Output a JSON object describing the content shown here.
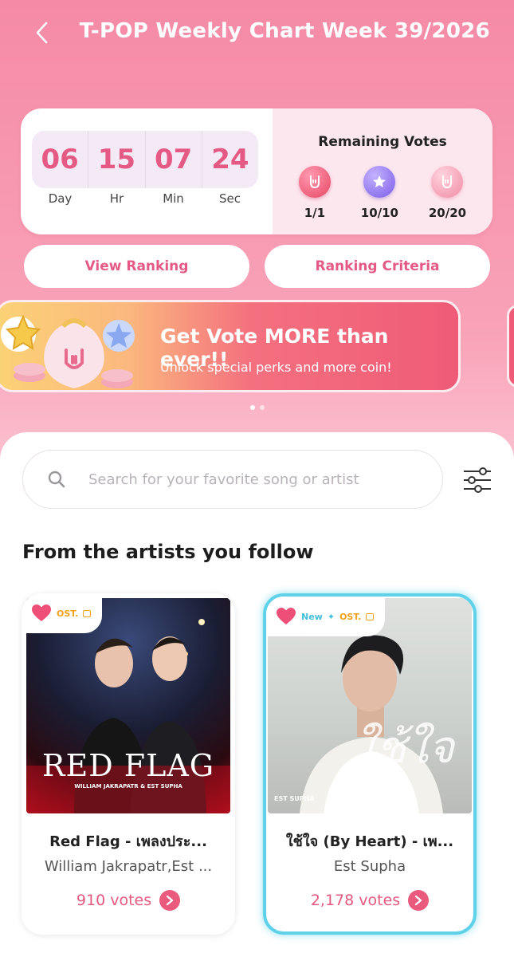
{
  "header": {
    "title": "T-POP Weekly Chart Week 39/2026"
  },
  "countdown": {
    "cells": [
      {
        "value": "06",
        "label": "Day"
      },
      {
        "value": "15",
        "label": "Hr"
      },
      {
        "value": "07",
        "label": "Min"
      },
      {
        "value": "24",
        "label": "Sec"
      }
    ]
  },
  "remaining_votes": {
    "title": "Remaining Votes",
    "coins": [
      {
        "icon": "rock-hand-coin-icon",
        "count": "1/1",
        "color": "#e84563"
      },
      {
        "icon": "star-coin-icon",
        "count": "10/10",
        "color": "#7b5ce8"
      },
      {
        "icon": "pink-hand-coin-icon",
        "count": "20/20",
        "color": "#f08aa3"
      }
    ]
  },
  "actions": {
    "view_ranking": "View Ranking",
    "ranking_criteria": "Ranking Criteria"
  },
  "banner": {
    "title": "Get Vote MORE than ever!!",
    "subtitle": "Unlock special perks and more coin!",
    "page_count": 2,
    "active_page": 1
  },
  "search": {
    "placeholder": "Search for your favorite song or artist",
    "value": ""
  },
  "section": {
    "title": "From the artists you follow"
  },
  "songs": [
    {
      "title": "Red Flag - เพลงประ...",
      "artist": "William Jakrapatr,Est ...",
      "votes": "910 votes",
      "tags": [
        "OST."
      ],
      "favorited": true,
      "highlighted": false,
      "cover_text": "RED FLAG",
      "cover_sub": "WILLIAM JAKRAPATR & EST SUPHA"
    },
    {
      "title": "ใช้ใจ (By Heart) - เพ...",
      "artist": "Est Supha",
      "votes": "2,178 votes",
      "tags": [
        "New",
        "OST."
      ],
      "favorited": true,
      "highlighted": true,
      "cover_text": "ใช้ใจ",
      "cover_sub": "EST SUPHA"
    }
  ],
  "colors": {
    "accent": "#e55a85",
    "highlight_border": "#5fd2ea",
    "ost_tag": "#f2a21a",
    "new_tag": "#45bfd8"
  }
}
